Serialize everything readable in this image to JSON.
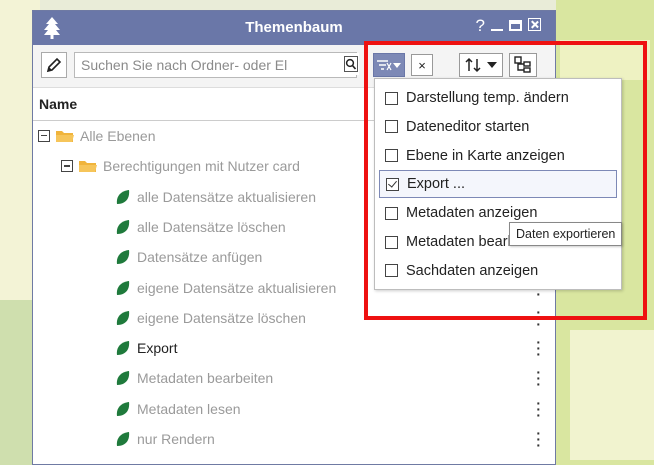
{
  "window": {
    "title": "Themenbaum",
    "help_label": "?",
    "minimize_label": "_"
  },
  "toolbar": {
    "search_placeholder": "Suchen Sie nach Ordner- oder El",
    "clear_label": "×"
  },
  "header": {
    "name": "Name"
  },
  "tree": [
    {
      "label": "Alle Ebenen",
      "level": 0,
      "kind": "folder",
      "expanded": true,
      "dim": true,
      "menu": false
    },
    {
      "label": "Berechtigungen mit Nutzer card",
      "level": 1,
      "kind": "folder",
      "expanded": true,
      "dim": true,
      "menu": false
    },
    {
      "label": "alle Datensätze aktualisieren",
      "level": 2,
      "kind": "leaf",
      "dim": true,
      "menu": false
    },
    {
      "label": "alle Datensätze löschen",
      "level": 2,
      "kind": "leaf",
      "dim": true,
      "menu": false
    },
    {
      "label": "Datensätze anfügen",
      "level": 2,
      "kind": "leaf",
      "dim": true,
      "menu": false
    },
    {
      "label": "eigene Datensätze aktualisieren",
      "level": 2,
      "kind": "leaf",
      "dim": true,
      "menu": true
    },
    {
      "label": "eigene Datensätze löschen",
      "level": 2,
      "kind": "leaf",
      "dim": true,
      "menu": true
    },
    {
      "label": "Export",
      "level": 2,
      "kind": "leaf",
      "dim": false,
      "menu": true
    },
    {
      "label": "Metadaten bearbeiten",
      "level": 2,
      "kind": "leaf",
      "dim": true,
      "menu": true
    },
    {
      "label": "Metadaten lesen",
      "level": 2,
      "kind": "leaf",
      "dim": true,
      "menu": true
    },
    {
      "label": "nur Rendern",
      "level": 2,
      "kind": "leaf",
      "dim": true,
      "menu": true
    }
  ],
  "filter_menu": {
    "items": [
      {
        "label": "Darstellung temp. ändern",
        "checked": false
      },
      {
        "label": "Dateneditor starten",
        "checked": false
      },
      {
        "label": "Ebene in Karte anzeigen",
        "checked": false
      },
      {
        "label": "Export ...",
        "checked": true
      },
      {
        "label": "Metadaten anzeigen",
        "checked": false
      },
      {
        "label": "Metadaten bearbeiten",
        "checked": false
      },
      {
        "label": "Sachdaten anzeigen",
        "checked": false
      }
    ]
  },
  "tooltip": "Daten exportieren",
  "colors": {
    "titlebar": "#6a77a8",
    "folder": "#f0b43c",
    "leaf": "#1f7a3c",
    "highlight": "#ee1111",
    "filter_active": "#7d89b6"
  },
  "icons": {
    "window": "tree-icon",
    "edit": "pencil-icon",
    "search": "search-icon",
    "filter": "filter-icon",
    "sort": "sort-icon",
    "tree_view": "tree-structure-icon",
    "row_menu": "kebab-menu-icon"
  }
}
